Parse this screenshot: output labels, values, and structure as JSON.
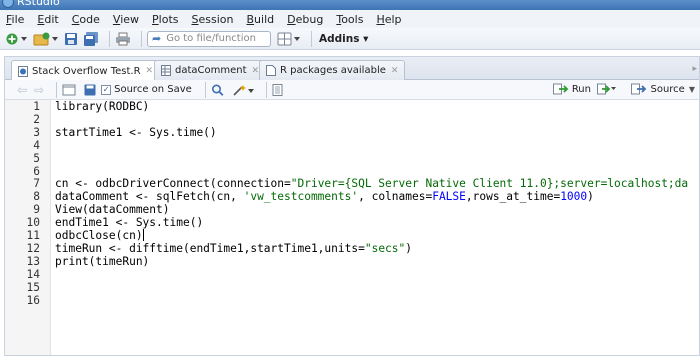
{
  "window": {
    "title": "RStudio"
  },
  "menu": [
    "File",
    "Edit",
    "Code",
    "View",
    "Plots",
    "Session",
    "Build",
    "Debug",
    "Tools",
    "Help"
  ],
  "toolbar": {
    "goto_placeholder": "Go to file/function",
    "addins_label": "Addins"
  },
  "tabs": [
    {
      "label": "Stack Overflow Test.R",
      "active": true,
      "icon": "r-script-icon"
    },
    {
      "label": "dataComment",
      "active": false,
      "icon": "table-icon"
    },
    {
      "label": "R packages available",
      "active": false,
      "icon": "document-icon"
    }
  ],
  "editor_toolbar": {
    "source_on_save": "Source on Save",
    "source_on_save_checked": true,
    "run_label": "Run",
    "source_label": "Source"
  },
  "line_numbers": [
    "1",
    "2",
    "3",
    "4",
    "5",
    "6",
    "7",
    "8",
    "9",
    "10",
    "11",
    "12",
    "13",
    "14",
    "15",
    "16"
  ],
  "code_lines": [
    "library(RODBC)",
    "",
    "startTime1 <- Sys.time()",
    "",
    "",
    "",
    "cn <- odbcDriverConnect(connection=\"Driver={SQL Server Native Client 11.0};server=localhost;da",
    "dataComment <- sqlFetch(cn, 'vw_testcomments', colnames=FALSE,rows_at_time=1000)",
    "View(dataComment)",
    "endTime1 <- Sys.time()",
    "odbcClose(cn)",
    "timeRun <- difftime(endTime1,startTime1,units=\"secs\")",
    "print(timeRun)",
    "",
    "",
    ""
  ],
  "colors": {
    "string": "#036a07",
    "keyword": "#0000ff",
    "number": "#0000ff",
    "run_arrow": "#2e9a33"
  }
}
